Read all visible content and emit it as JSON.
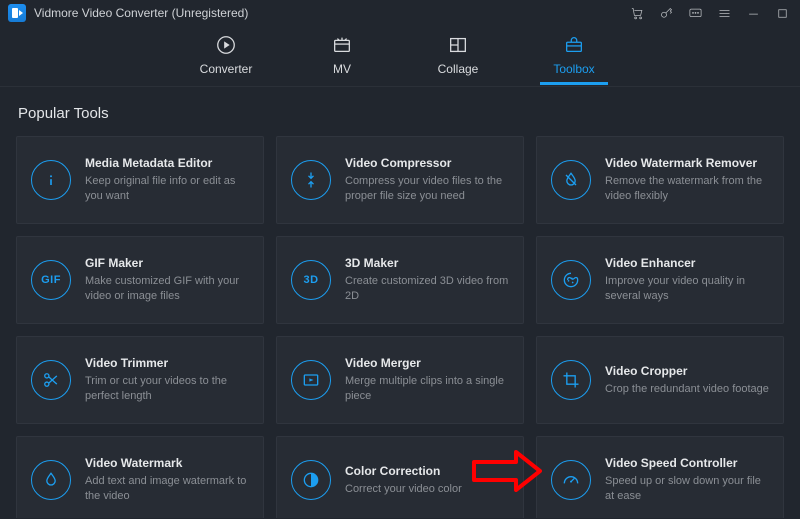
{
  "app": {
    "title": "Vidmore Video Converter (Unregistered)"
  },
  "nav": {
    "items": [
      {
        "label": "Converter"
      },
      {
        "label": "MV"
      },
      {
        "label": "Collage"
      },
      {
        "label": "Toolbox"
      }
    ],
    "active_index": 3
  },
  "section": {
    "title": "Popular Tools"
  },
  "tools": [
    {
      "title": "Media Metadata Editor",
      "desc": "Keep original file info or edit as you want",
      "icon": "info"
    },
    {
      "title": "Video Compressor",
      "desc": "Compress your video files to the proper file size you need",
      "icon": "compress"
    },
    {
      "title": "Video Watermark Remover",
      "desc": "Remove the watermark from the video flexibly",
      "icon": "nodrop"
    },
    {
      "title": "GIF Maker",
      "desc": "Make customized GIF with your video or image files",
      "icon": "gif"
    },
    {
      "title": "3D Maker",
      "desc": "Create customized 3D video from 2D",
      "icon": "3d"
    },
    {
      "title": "Video Enhancer",
      "desc": "Improve your video quality in several ways",
      "icon": "enhance"
    },
    {
      "title": "Video Trimmer",
      "desc": "Trim or cut your videos to the perfect length",
      "icon": "trim"
    },
    {
      "title": "Video Merger",
      "desc": "Merge multiple clips into a single piece",
      "icon": "merge"
    },
    {
      "title": "Video Cropper",
      "desc": "Crop the redundant video footage",
      "icon": "crop"
    },
    {
      "title": "Video Watermark",
      "desc": "Add text and image watermark to the video",
      "icon": "drop"
    },
    {
      "title": "Color Correction",
      "desc": "Correct your video color",
      "icon": "color"
    },
    {
      "title": "Video Speed Controller",
      "desc": "Speed up or slow down your file at ease",
      "icon": "speed"
    }
  ],
  "icon_text": {
    "gif": "GIF",
    "3d": "3D"
  }
}
